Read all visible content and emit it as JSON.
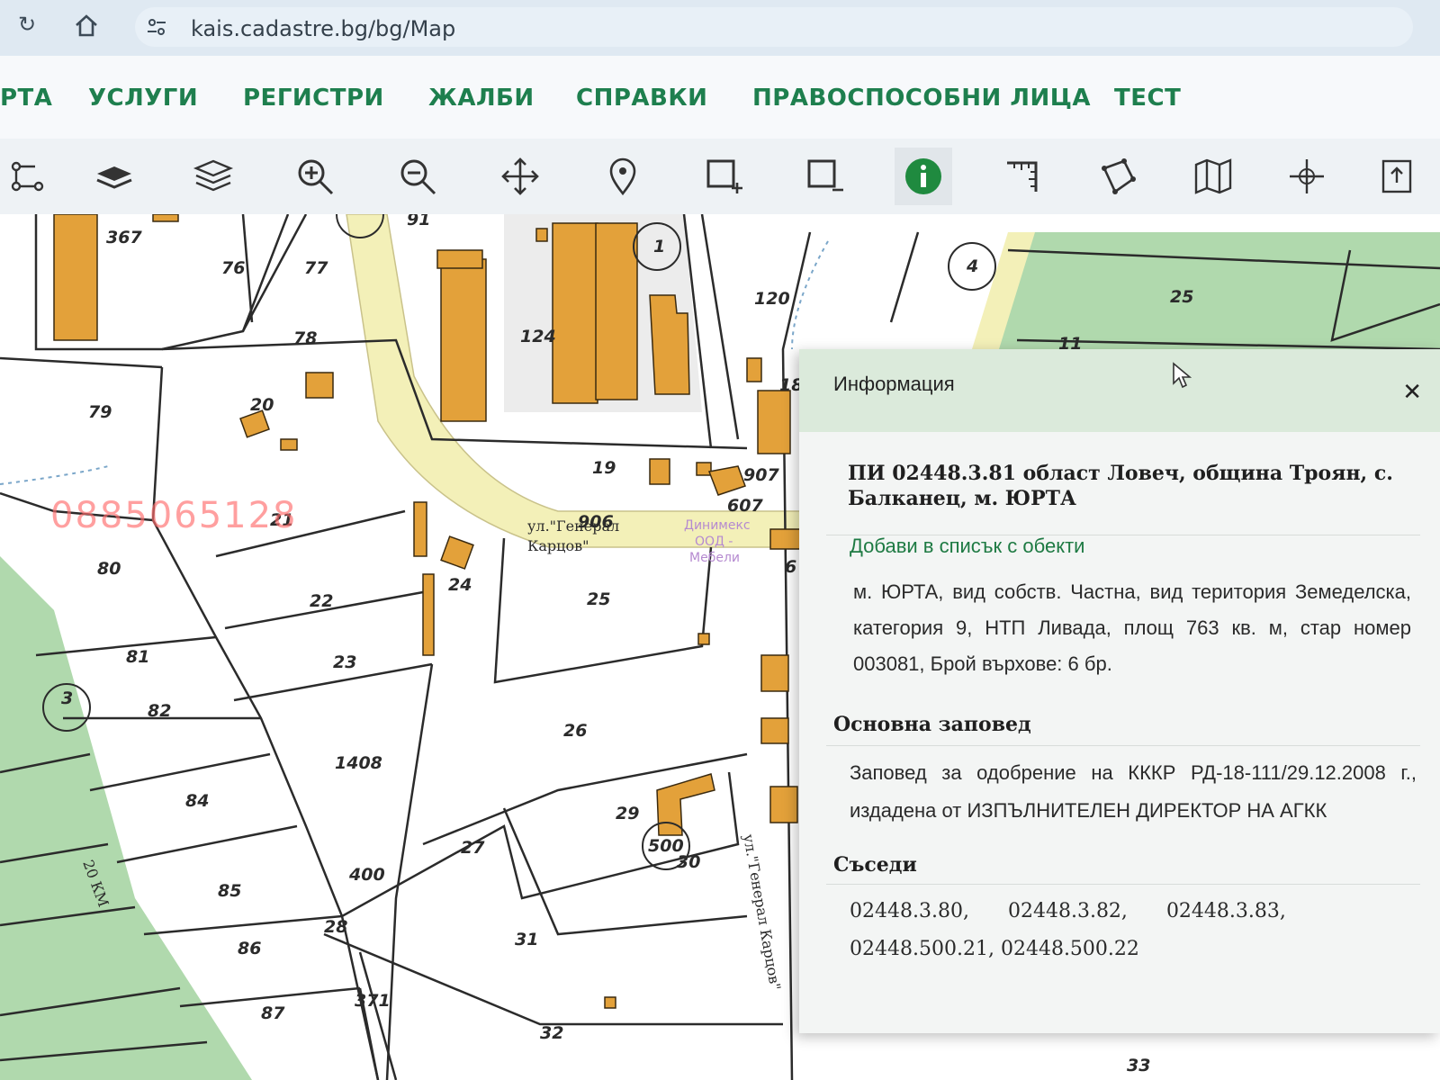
{
  "browser": {
    "url": "kais.cadastre.bg/bg/Map"
  },
  "menu": {
    "items": [
      "РТА",
      "УСЛУГИ",
      "РЕГИСТРИ",
      "ЖАЛБИ",
      "СПРАВКИ",
      "ПРАВОСПОСОБНИ ЛИЦА",
      "ТЕСТ"
    ]
  },
  "toolbar": {
    "tools": [
      "route-tool-icon",
      "layers-flat-icon",
      "layers-stack-icon",
      "zoom-in-icon",
      "zoom-out-icon",
      "pan-icon",
      "location-pin-icon",
      "select-add-icon",
      "select-remove-icon",
      "info-icon",
      "measure-icon",
      "polygon-icon",
      "map-icon",
      "crosshair-icon",
      "export-icon"
    ],
    "active_tool": "info-icon"
  },
  "map": {
    "watermark": "0885065128",
    "street_label_1": "ул.\"Генерал",
    "street_label_2": "Карцов\"",
    "side_street_label": "ул.\"Генерал Карцов\"",
    "faded_label_1": "Динимекс",
    "faded_label_2": "ООД -",
    "faded_label_3": "Мебели",
    "plot_labels": [
      "367",
      "76",
      "77",
      "78",
      "79",
      "91",
      "124",
      "120",
      "25",
      "11",
      "4",
      "1",
      "18",
      "20",
      "19",
      "907",
      "607",
      "906",
      "21",
      "80",
      "22",
      "24",
      "25",
      "81",
      "23",
      "3",
      "82",
      "26",
      "1408",
      "84",
      "29",
      "500",
      "30",
      "27",
      "85",
      "400",
      "28",
      "31",
      "86",
      "371",
      "87",
      "32",
      "33",
      "6"
    ],
    "side_road_label": "20 КМ",
    "colors": {
      "building": "#e3a13a",
      "road": "#f3f0b8",
      "green": "#8ec98a",
      "line": "#2b2b2b"
    }
  },
  "info_panel": {
    "title": "Информация",
    "plot_id": "ПИ 02448.3.81 област Ловеч, община Троян, с. Балканец, м. ЮРТА",
    "add_link": "Добави в списък с обекти",
    "details": "м. ЮРТА, вид собств. Частна, вид територия Земеделска, категория 9, НТП Ливада, площ 763 кв. м, стар номер 003081, Брой върхове: 6 бр.",
    "order_heading": "Основна заповед",
    "order_text": "Заповед за одобрение на КККР РД-18-111/29.12.2008 г., издадена от ИЗПЪЛНИТЕЛЕН ДИРЕКТОР НА АГКК",
    "neighbors_heading": "Съседи",
    "neighbors": [
      "02448.3.80,",
      "02448.3.82,",
      "02448.3.83,",
      "02448.500.21,",
      "02448.500.22"
    ]
  }
}
